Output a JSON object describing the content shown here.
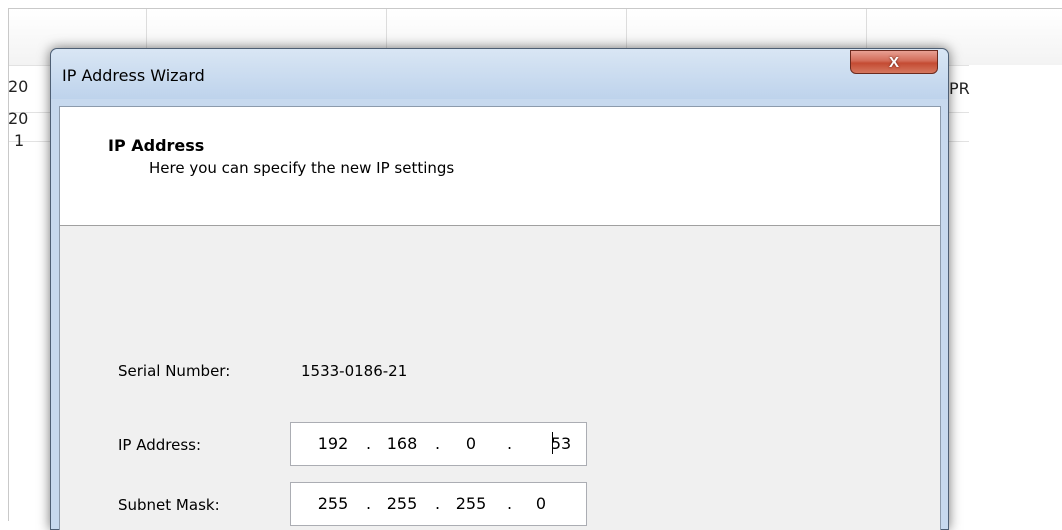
{
  "background": {
    "row_prefixes": [
      "20",
      "20",
      "1"
    ],
    "right_fragment": "PR"
  },
  "dialog": {
    "title": "IP Address Wizard",
    "close_glyph": "X",
    "heading": "IP Address",
    "subheading": "Here you can specify the new IP settings",
    "serial": {
      "label": "Serial Number:",
      "value": "1533-0186-21"
    },
    "ip_address": {
      "label": "IP Address:",
      "octets": [
        "192",
        "168",
        "0",
        "53"
      ]
    },
    "subnet_mask": {
      "label": "Subnet Mask:",
      "octets": [
        "255",
        "255",
        "255",
        "0"
      ]
    },
    "separator": "."
  }
}
